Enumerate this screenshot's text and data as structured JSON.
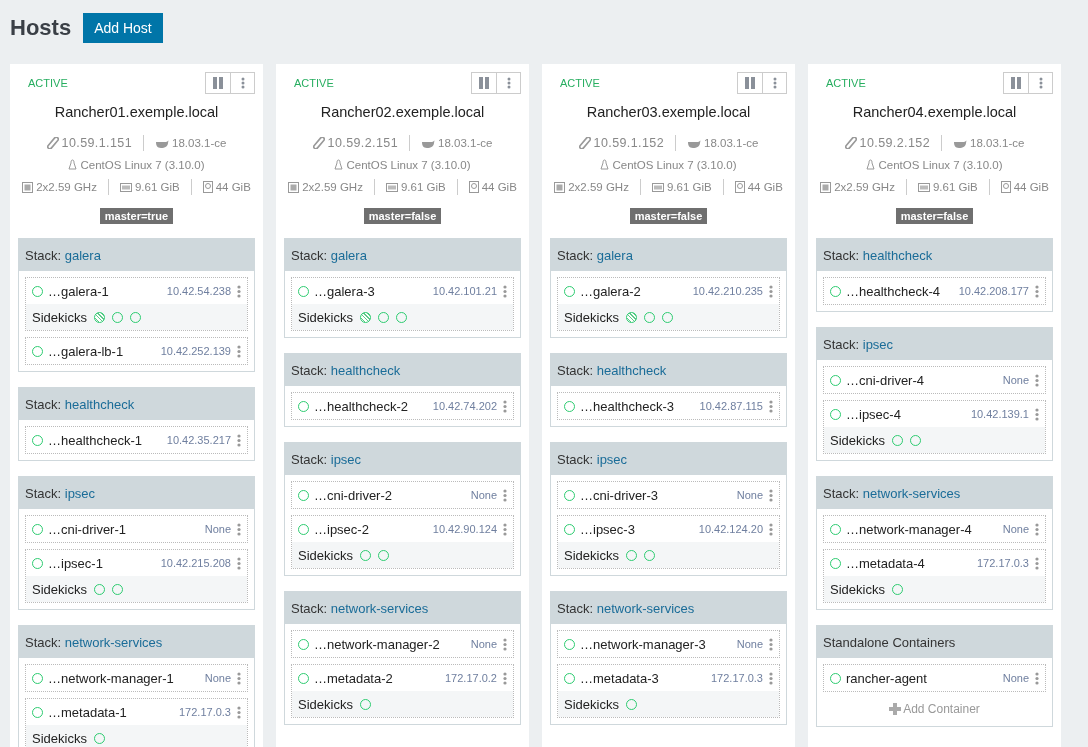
{
  "page": {
    "title": "Hosts",
    "add_button": "Add Host"
  },
  "hosts": [
    {
      "state": "ACTIVE",
      "name": "Rancher01.exemple.local",
      "ip": "10.59.1.151",
      "docker": "18.03.1-ce",
      "os": "CentOS Linux 7 (3.10.0)",
      "cpu": "2x2.59 GHz",
      "ram": "9.61 GiB",
      "disk": "44 GiB",
      "label": "master=true",
      "stacks": [
        {
          "kind": "stack",
          "prefix": "Stack:",
          "name": "galera",
          "containers": [
            {
              "name": "…galera-1",
              "ip": "10.42.54.238",
              "sidekicks_label": "Sidekicks",
              "sidekicks": [
                {
                  "hatched": true
                },
                {
                  "hatched": false
                },
                {
                  "hatched": false
                }
              ]
            },
            {
              "name": "…galera-lb-1",
              "ip": "10.42.252.139"
            }
          ]
        },
        {
          "kind": "stack",
          "prefix": "Stack:",
          "name": "healthcheck",
          "containers": [
            {
              "name": "…healthcheck-1",
              "ip": "10.42.35.217"
            }
          ]
        },
        {
          "kind": "stack",
          "prefix": "Stack:",
          "name": "ipsec",
          "containers": [
            {
              "name": "…cni-driver-1",
              "ip": "None"
            },
            {
              "name": "…ipsec-1",
              "ip": "10.42.215.208",
              "sidekicks_label": "Sidekicks",
              "sidekicks": [
                {
                  "hatched": false
                },
                {
                  "hatched": false
                }
              ]
            }
          ]
        },
        {
          "kind": "stack",
          "prefix": "Stack:",
          "name": "network-services",
          "containers": [
            {
              "name": "…network-manager-1",
              "ip": "None"
            },
            {
              "name": "…metadata-1",
              "ip": "172.17.0.3",
              "sidekicks_label": "Sidekicks",
              "sidekicks": [
                {
                  "hatched": false
                }
              ]
            }
          ]
        }
      ]
    },
    {
      "state": "ACTIVE",
      "name": "Rancher02.exemple.local",
      "ip": "10.59.2.151",
      "docker": "18.03.1-ce",
      "os": "CentOS Linux 7 (3.10.0)",
      "cpu": "2x2.59 GHz",
      "ram": "9.61 GiB",
      "disk": "44 GiB",
      "label": "master=false",
      "stacks": [
        {
          "kind": "stack",
          "prefix": "Stack:",
          "name": "galera",
          "containers": [
            {
              "name": "…galera-3",
              "ip": "10.42.101.21",
              "sidekicks_label": "Sidekicks",
              "sidekicks": [
                {
                  "hatched": true
                },
                {
                  "hatched": false
                },
                {
                  "hatched": false
                }
              ]
            }
          ]
        },
        {
          "kind": "stack",
          "prefix": "Stack:",
          "name": "healthcheck",
          "containers": [
            {
              "name": "…healthcheck-2",
              "ip": "10.42.74.202"
            }
          ]
        },
        {
          "kind": "stack",
          "prefix": "Stack:",
          "name": "ipsec",
          "containers": [
            {
              "name": "…cni-driver-2",
              "ip": "None"
            },
            {
              "name": "…ipsec-2",
              "ip": "10.42.90.124",
              "sidekicks_label": "Sidekicks",
              "sidekicks": [
                {
                  "hatched": false
                },
                {
                  "hatched": false
                }
              ]
            }
          ]
        },
        {
          "kind": "stack",
          "prefix": "Stack:",
          "name": "network-services",
          "containers": [
            {
              "name": "…network-manager-2",
              "ip": "None"
            },
            {
              "name": "…metadata-2",
              "ip": "172.17.0.2",
              "sidekicks_label": "Sidekicks",
              "sidekicks": [
                {
                  "hatched": false
                }
              ]
            }
          ]
        }
      ]
    },
    {
      "state": "ACTIVE",
      "name": "Rancher03.exemple.local",
      "ip": "10.59.1.152",
      "docker": "18.03.1-ce",
      "os": "CentOS Linux 7 (3.10.0)",
      "cpu": "2x2.59 GHz",
      "ram": "9.61 GiB",
      "disk": "44 GiB",
      "label": "master=false",
      "stacks": [
        {
          "kind": "stack",
          "prefix": "Stack:",
          "name": "galera",
          "containers": [
            {
              "name": "…galera-2",
              "ip": "10.42.210.235",
              "sidekicks_label": "Sidekicks",
              "sidekicks": [
                {
                  "hatched": true
                },
                {
                  "hatched": false
                },
                {
                  "hatched": false
                }
              ]
            }
          ]
        },
        {
          "kind": "stack",
          "prefix": "Stack:",
          "name": "healthcheck",
          "containers": [
            {
              "name": "…healthcheck-3",
              "ip": "10.42.87.115"
            }
          ]
        },
        {
          "kind": "stack",
          "prefix": "Stack:",
          "name": "ipsec",
          "containers": [
            {
              "name": "…cni-driver-3",
              "ip": "None"
            },
            {
              "name": "…ipsec-3",
              "ip": "10.42.124.20",
              "sidekicks_label": "Sidekicks",
              "sidekicks": [
                {
                  "hatched": false
                },
                {
                  "hatched": false
                }
              ]
            }
          ]
        },
        {
          "kind": "stack",
          "prefix": "Stack:",
          "name": "network-services",
          "containers": [
            {
              "name": "…network-manager-3",
              "ip": "None"
            },
            {
              "name": "…metadata-3",
              "ip": "172.17.0.3",
              "sidekicks_label": "Sidekicks",
              "sidekicks": [
                {
                  "hatched": false
                }
              ]
            }
          ]
        }
      ]
    },
    {
      "state": "ACTIVE",
      "name": "Rancher04.exemple.local",
      "ip": "10.59.2.152",
      "docker": "18.03.1-ce",
      "os": "CentOS Linux 7 (3.10.0)",
      "cpu": "2x2.59 GHz",
      "ram": "9.61 GiB",
      "disk": "44 GiB",
      "label": "master=false",
      "stacks": [
        {
          "kind": "stack",
          "prefix": "Stack:",
          "name": "healthcheck",
          "containers": [
            {
              "name": "…healthcheck-4",
              "ip": "10.42.208.177"
            }
          ]
        },
        {
          "kind": "stack",
          "prefix": "Stack:",
          "name": "ipsec",
          "containers": [
            {
              "name": "…cni-driver-4",
              "ip": "None"
            },
            {
              "name": "…ipsec-4",
              "ip": "10.42.139.1",
              "sidekicks_label": "Sidekicks",
              "sidekicks": [
                {
                  "hatched": false
                },
                {
                  "hatched": false
                }
              ]
            }
          ]
        },
        {
          "kind": "stack",
          "prefix": "Stack:",
          "name": "network-services",
          "containers": [
            {
              "name": "…network-manager-4",
              "ip": "None"
            },
            {
              "name": "…metadata-4",
              "ip": "172.17.0.3",
              "sidekicks_label": "Sidekicks",
              "sidekicks": [
                {
                  "hatched": false
                }
              ]
            }
          ]
        },
        {
          "kind": "standalone",
          "name": "Standalone Containers",
          "containers": [
            {
              "name": "rancher-agent",
              "ip": "None"
            }
          ],
          "add_label": "Add Container"
        }
      ]
    }
  ]
}
